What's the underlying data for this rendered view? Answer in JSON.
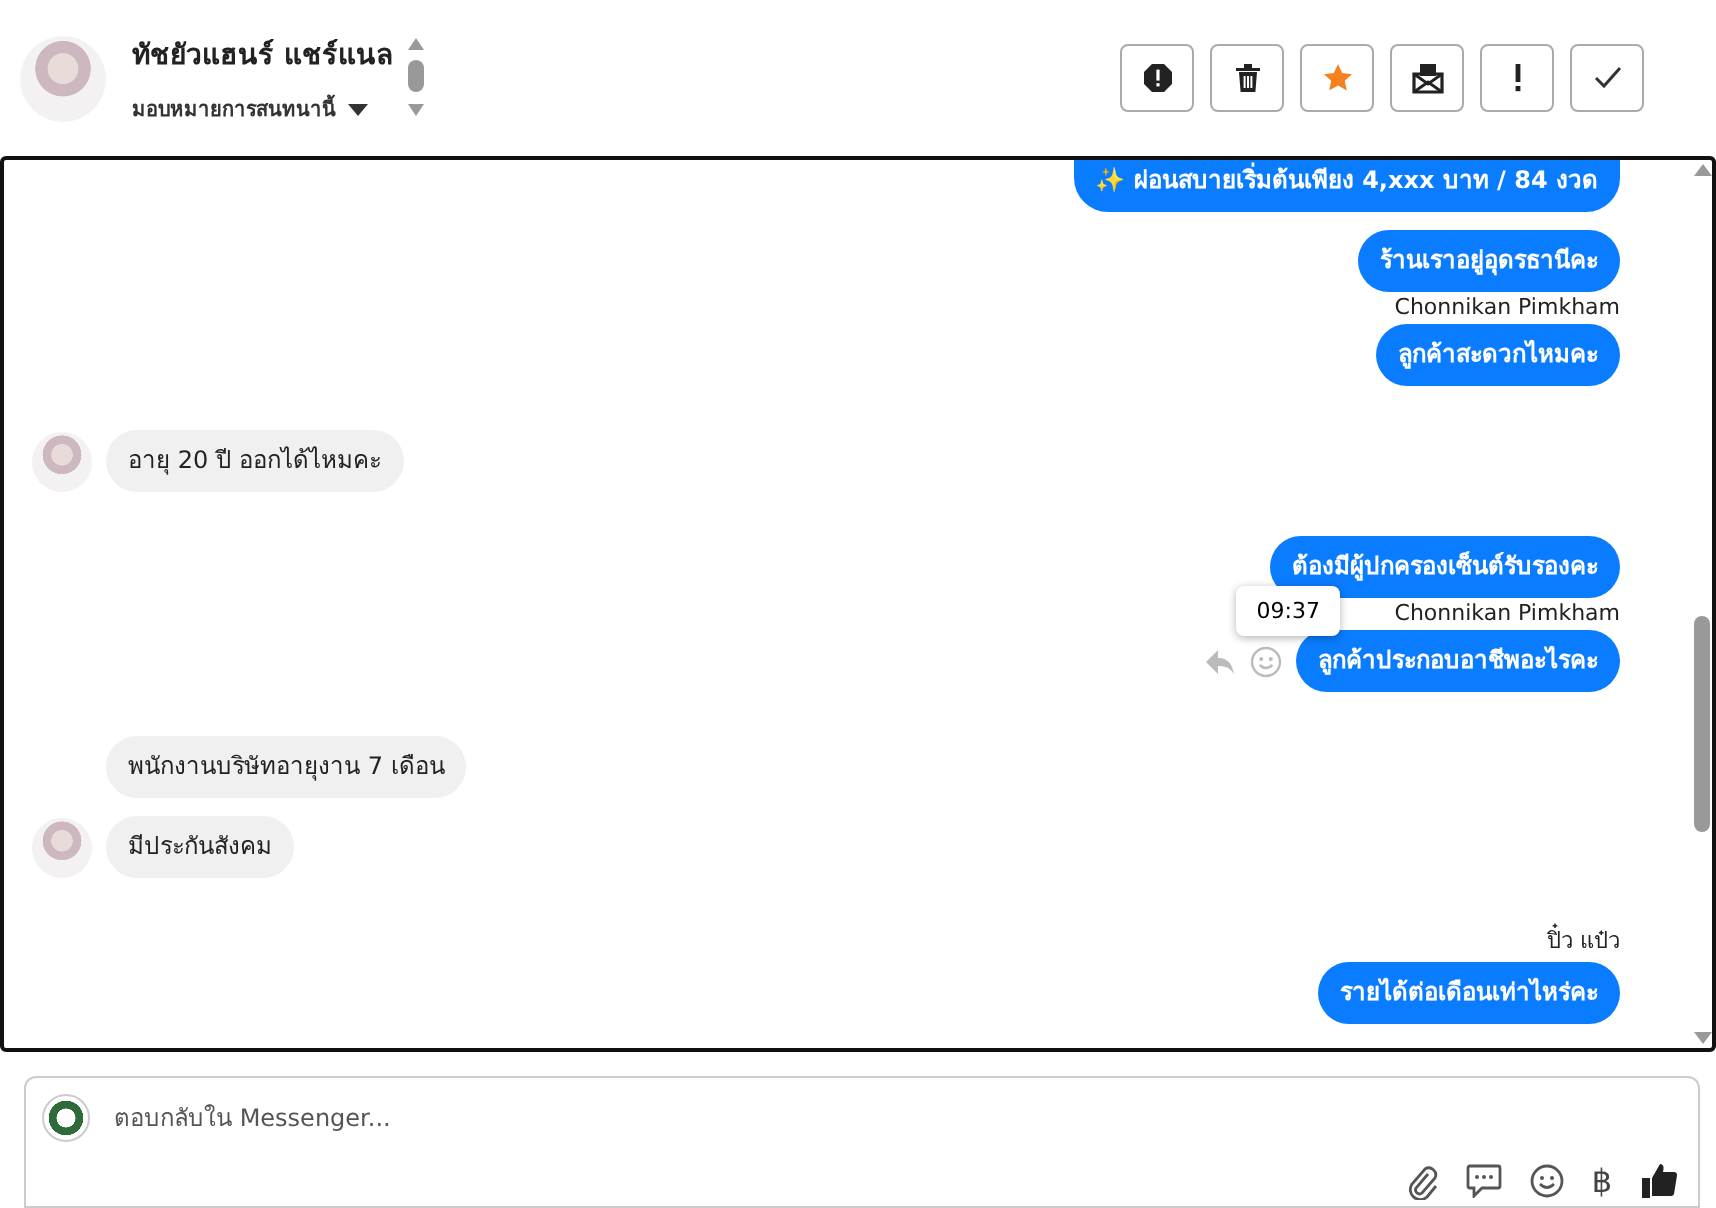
{
  "header": {
    "name": "ทัชยัวแฮนร์ แชร์แนล",
    "assign_label": "มอบหมายการสนทนานี้",
    "actions": [
      {
        "kind": "block"
      },
      {
        "kind": "trash"
      },
      {
        "kind": "star"
      },
      {
        "kind": "mail"
      },
      {
        "kind": "important"
      },
      {
        "kind": "done"
      }
    ]
  },
  "messages": [
    {
      "kind": "outgoing",
      "text": "✨ ผ่อนสบายเริ่มต้นเพียง 4,xxx บาท / 84 งวด",
      "cut": true
    },
    {
      "kind": "outgoing",
      "text": "ร้านเราอยู่อุดรธานีคะ"
    },
    {
      "kind": "sender",
      "text": "Chonnikan Pimkham"
    },
    {
      "kind": "outgoing",
      "text": "ลูกค้าสะดวกไหมคะ"
    },
    {
      "kind": "incoming",
      "text": "อายุ 20 ปี ออกได้ไหมคะ",
      "avatar": true
    },
    {
      "kind": "outgoing",
      "text": "ต้องมีผู้ปกครองเซ็นต์รับรองคะ",
      "tooltip": "09:37"
    },
    {
      "kind": "sender",
      "text": "Chonnikan Pimkham"
    },
    {
      "kind": "outgoing",
      "text": "ลูกค้าประกอบอาชีพอะไรคะ",
      "hover": true
    },
    {
      "kind": "incoming",
      "text": "พนักงานบริษัทอายุงาน 7 เดือน",
      "avatar": false
    },
    {
      "kind": "incoming",
      "text": "มีประกันสังคม",
      "avatar": true
    },
    {
      "kind": "sender",
      "text": "ปิ๋ว แป๋ว"
    },
    {
      "kind": "outgoing",
      "text": "รายได้ต่อเดือนเท่าไหร่คะ"
    }
  ],
  "composer": {
    "placeholder": "ตอบกลับใน Messenger...",
    "currency_symbol": "฿"
  }
}
